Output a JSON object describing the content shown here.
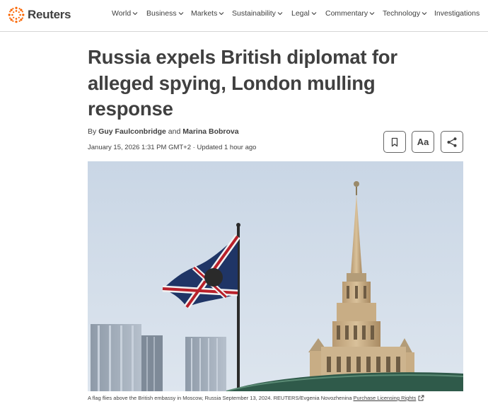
{
  "header": {
    "brand": "Reuters",
    "brand_color": "#fa6400",
    "nav": [
      {
        "label": "World",
        "has_dropdown": true
      },
      {
        "label": "Business",
        "has_dropdown": true
      },
      {
        "label": "Markets",
        "has_dropdown": true
      },
      {
        "label": "Sustainability",
        "has_dropdown": true
      },
      {
        "label": "Legal",
        "has_dropdown": true
      },
      {
        "label": "Commentary",
        "has_dropdown": true
      },
      {
        "label": "Technology",
        "has_dropdown": true
      },
      {
        "label": "Investigations",
        "has_dropdown": false
      }
    ]
  },
  "article": {
    "headline_lines": [
      "Russia expels British diplomat for",
      "alleged spying, London mulling",
      "response"
    ],
    "byline_prefix": "By",
    "author1": "Guy Faulconbridge",
    "byline_and": "and",
    "author2": "Marina Bobrova",
    "dateline": "January 15, 2026 1:31 PM GMT+2 · Updated 1 hour ago",
    "actions": [
      {
        "name": "bookmark",
        "icon": "bookmark-icon"
      },
      {
        "name": "text-size",
        "label": "Aa"
      },
      {
        "name": "share",
        "icon": "share-icon"
      }
    ],
    "caption": "A flag flies above the British embassy in Moscow, Russia September 13, 2024. REUTERS/Evgenia Novozhenina",
    "licensing_link": "Purchase Licensing Rights"
  }
}
